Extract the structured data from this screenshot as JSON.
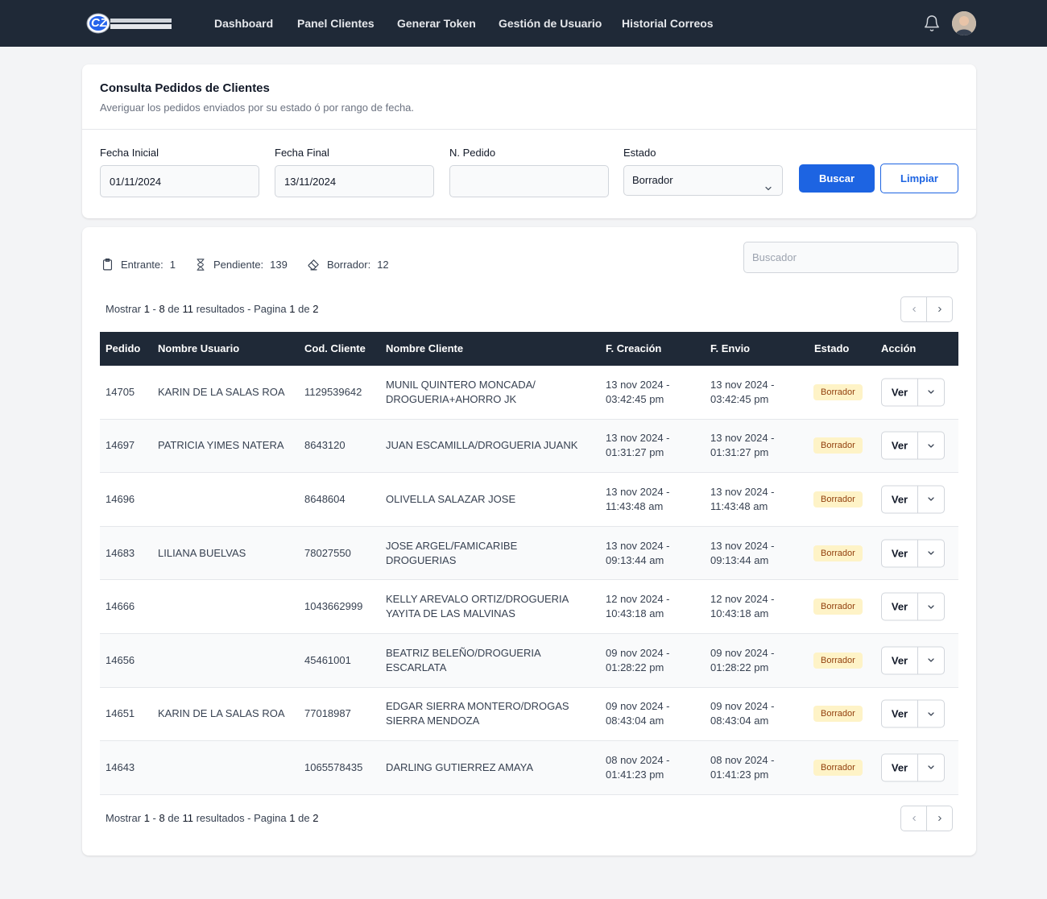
{
  "nav": {
    "logo_text": "CZ",
    "items": [
      {
        "label": "Dashboard"
      },
      {
        "label": "Panel Clientes"
      },
      {
        "label": "Generar Token"
      },
      {
        "label": "Gestión de Usuario"
      },
      {
        "label": "Historial Correos"
      }
    ],
    "bell_icon": "bell-icon",
    "avatar_icon": "user-avatar"
  },
  "filters": {
    "title": "Consulta Pedidos de Clientes",
    "subtitle": "Averiguar los pedidos enviados por su estado ó por rango de fecha.",
    "fecha_inicial_label": "Fecha Inicial",
    "fecha_inicial_value": "01/11/2024",
    "fecha_final_label": "Fecha Final",
    "fecha_final_value": "13/11/2024",
    "pedido_label": "N. Pedido",
    "pedido_value": "",
    "estado_label": "Estado",
    "estado_value": "Borrador",
    "buscar_label": "Buscar",
    "limpiar_label": "Limpiar"
  },
  "stats": {
    "entrante_label": "Entrante:",
    "entrante_value": "1",
    "pendiente_label": "Pendiente:",
    "pendiente_value": "139",
    "borrador_label": "Borrador:",
    "borrador_value": "12"
  },
  "search": {
    "placeholder": "Buscador"
  },
  "pagination": {
    "mostrar": "Mostrar",
    "from": "1",
    "sep": "-",
    "to": "8",
    "de": "de",
    "total": "11",
    "resultados": "resultados - Pagina",
    "page": "1",
    "de2": "de",
    "pages": "2"
  },
  "table": {
    "headers": {
      "pedido": "Pedido",
      "usuario": "Nombre Usuario",
      "cod": "Cod. Cliente",
      "cliente": "Nombre Cliente",
      "creacion": "F. Creación",
      "envio": "F. Envio",
      "estado": "Estado",
      "accion": "Acción"
    },
    "ver_label": "Ver",
    "rows": [
      {
        "pedido": "14705",
        "usuario": "KARIN DE LA SALAS ROA",
        "cod": "1129539642",
        "cliente": "MUNIL QUINTERO MONCADA/\nDROGUERIA+AHORRO JK",
        "creacion": "13 nov 2024 -\n03:42:45 pm",
        "envio": "13 nov 2024 -\n03:42:45 pm",
        "estado": "Borrador"
      },
      {
        "pedido": "14697",
        "usuario": "PATRICIA YIMES NATERA",
        "cod": "8643120",
        "cliente": "JUAN ESCAMILLA/DROGUERIA JUANK",
        "creacion": "13 nov 2024 -\n01:31:27 pm",
        "envio": "13 nov 2024 -\n01:31:27 pm",
        "estado": "Borrador"
      },
      {
        "pedido": "14696",
        "usuario": "",
        "cod": "8648604",
        "cliente": "OLIVELLA SALAZAR JOSE",
        "creacion": "13 nov 2024 -\n11:43:48 am",
        "envio": "13 nov 2024 -\n11:43:48 am",
        "estado": "Borrador"
      },
      {
        "pedido": "14683",
        "usuario": "LILIANA BUELVAS",
        "cod": "78027550",
        "cliente": "JOSE ARGEL/FAMICARIBE\nDROGUERIAS",
        "creacion": "13 nov 2024 -\n09:13:44 am",
        "envio": "13 nov 2024 -\n09:13:44 am",
        "estado": "Borrador"
      },
      {
        "pedido": "14666",
        "usuario": "",
        "cod": "1043662999",
        "cliente": "KELLY AREVALO ORTIZ/DROGUERIA\nYAYITA DE LAS MALVINAS",
        "creacion": "12 nov 2024 -\n10:43:18 am",
        "envio": "12 nov 2024 -\n10:43:18 am",
        "estado": "Borrador"
      },
      {
        "pedido": "14656",
        "usuario": "",
        "cod": "45461001",
        "cliente": "BEATRIZ BELEÑO/DROGUERIA\nESCARLATA",
        "creacion": "09 nov 2024 -\n01:28:22 pm",
        "envio": "09 nov 2024 -\n01:28:22 pm",
        "estado": "Borrador"
      },
      {
        "pedido": "14651",
        "usuario": "KARIN DE LA SALAS ROA",
        "cod": "77018987",
        "cliente": "EDGAR SIERRA MONTERO/DROGAS\nSIERRA MENDOZA",
        "creacion": "09 nov 2024 -\n08:43:04 am",
        "envio": "09 nov 2024 -\n08:43:04 am",
        "estado": "Borrador"
      },
      {
        "pedido": "14643",
        "usuario": "",
        "cod": "1065578435",
        "cliente": "DARLING GUTIERREZ AMAYA",
        "creacion": "08 nov 2024 -\n01:41:23 pm",
        "envio": "08 nov 2024 -\n01:41:23 pm",
        "estado": "Borrador"
      }
    ]
  },
  "colors": {
    "navbar": "#1f2937",
    "primary": "#1d64e2",
    "badge_bg": "#fef3c7",
    "badge_text": "#92400e"
  }
}
